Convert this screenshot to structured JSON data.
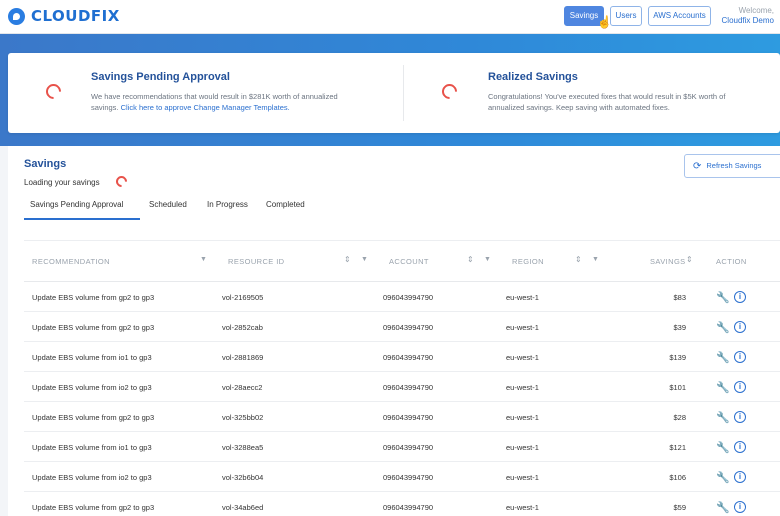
{
  "header": {
    "brand": "CLOUDFIX",
    "nav": [
      {
        "label": "Savings",
        "active": true
      },
      {
        "label": "Users",
        "active": false
      },
      {
        "label": "AWS Accounts",
        "active": false
      }
    ],
    "welcome": "Welcome,",
    "user": "Cloudfix Demo"
  },
  "summary": {
    "pending": {
      "title": "Savings Pending Approval",
      "text": "We have recommendations that would result in $281K worth of annualized savings.",
      "link": "Click here to approve Change Manager Templates."
    },
    "realized": {
      "title": "Realized Savings",
      "text": "Congratulations! You've executed fixes that would result in $5K worth of annualized savings. Keep saving with automated fixes."
    }
  },
  "savings": {
    "title": "Savings",
    "loading": "Loading your savings",
    "refresh_label": "Refresh Savings",
    "tabs": [
      {
        "label": "Savings Pending Approval",
        "active": true
      },
      {
        "label": "Scheduled",
        "active": false
      },
      {
        "label": "In Progress",
        "active": false
      },
      {
        "label": "Completed",
        "active": false
      }
    ],
    "columns": [
      "RECOMMENDATION",
      "RESOURCE ID",
      "ACCOUNT",
      "REGION",
      "SAVINGS",
      "ACTION"
    ],
    "rows": [
      {
        "recommendation": "Update EBS volume from gp2 to gp3",
        "resource": "vol-2169505",
        "account": "096043994790",
        "region": "eu-west-1",
        "savings": "$83"
      },
      {
        "recommendation": "Update EBS volume from gp2 to gp3",
        "resource": "vol-2852cab",
        "account": "096043994790",
        "region": "eu-west-1",
        "savings": "$39"
      },
      {
        "recommendation": "Update EBS volume from io1 to gp3",
        "resource": "vol-2881869",
        "account": "096043994790",
        "region": "eu-west-1",
        "savings": "$139"
      },
      {
        "recommendation": "Update EBS volume from io2 to gp3",
        "resource": "vol-28aecc2",
        "account": "096043994790",
        "region": "eu-west-1",
        "savings": "$101"
      },
      {
        "recommendation": "Update EBS volume from gp2 to gp3",
        "resource": "vol-325bb02",
        "account": "096043994790",
        "region": "eu-west-1",
        "savings": "$28"
      },
      {
        "recommendation": "Update EBS volume from io1 to gp3",
        "resource": "vol-3288ea5",
        "account": "096043994790",
        "region": "eu-west-1",
        "savings": "$121"
      },
      {
        "recommendation": "Update EBS volume from io2 to gp3",
        "resource": "vol-32b6b04",
        "account": "096043994790",
        "region": "eu-west-1",
        "savings": "$106"
      },
      {
        "recommendation": "Update EBS volume from gp2 to gp3",
        "resource": "vol-34ab6ed",
        "account": "096043994790",
        "region": "eu-west-1",
        "savings": "$59"
      }
    ]
  },
  "icons": {
    "logo": "cloudfix-logo-icon",
    "refresh": "refresh-icon",
    "sort": "sort-arrows-icon",
    "filter": "filter-funnel-icon",
    "fix": "wrench-fix-icon",
    "info": "info-circle-icon",
    "spinner": "loading-spinner-icon",
    "cursor": "hand-pointer-icon"
  },
  "colors": {
    "brand": "#1f6fd1",
    "heading": "#24529a",
    "accent": "#2a6fcf",
    "spinner": "#e8524a",
    "band": "#2f88d8"
  }
}
